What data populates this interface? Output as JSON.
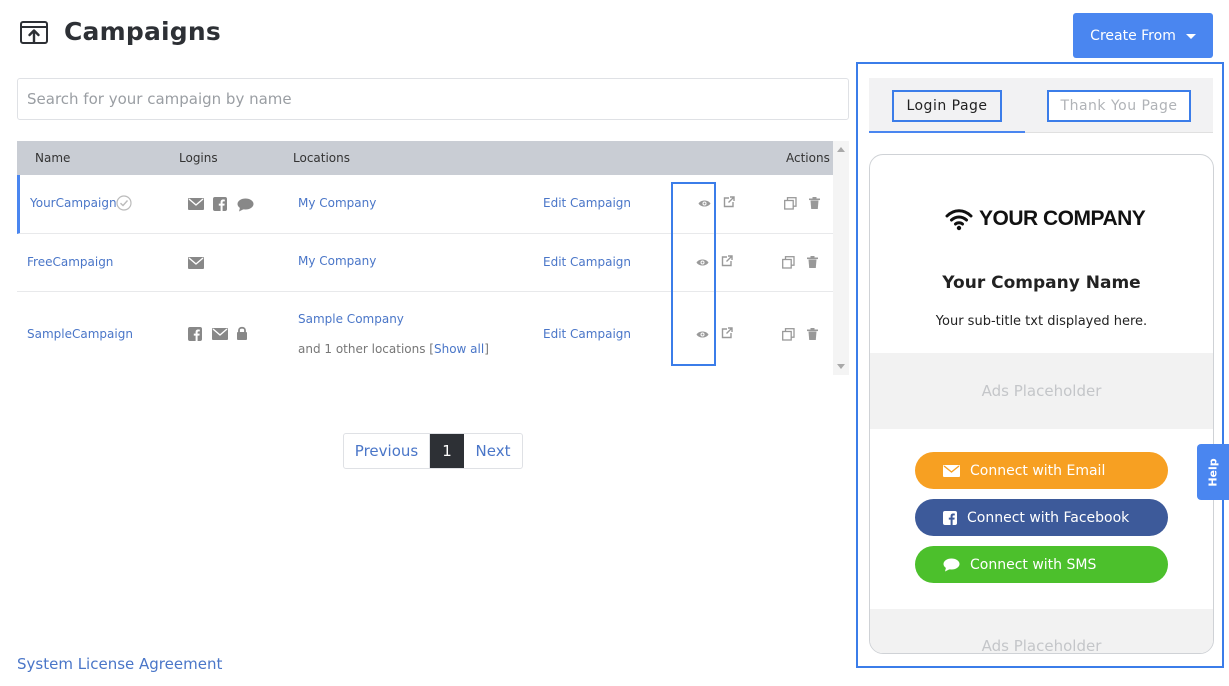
{
  "header": {
    "title": "Campaigns",
    "create_label": "Create From",
    "title_icon": "upload-box-icon"
  },
  "search": {
    "placeholder": "Search for your campaign by name",
    "value": ""
  },
  "table": {
    "columns": [
      "Name",
      "Logins",
      "Locations",
      "Actions"
    ],
    "rows": [
      {
        "name": "YourCampaign",
        "verified": true,
        "logins": [
          "email-icon",
          "facebook-icon",
          "sms-icon"
        ],
        "location": "My Company",
        "location_extra": "",
        "edit_label": "Edit Campaign"
      },
      {
        "name": "FreeCampaign",
        "verified": false,
        "logins": [
          "email-icon"
        ],
        "location": "My Company",
        "location_extra": "",
        "edit_label": "Edit Campaign"
      },
      {
        "name": "SampleCampaign",
        "verified": false,
        "logins": [
          "facebook-icon",
          "email-icon",
          "lock-icon"
        ],
        "location": "Sample Company",
        "location_extra": "and 1 other locations [",
        "show_all": "Show all",
        "show_all_close": "]",
        "edit_label": "Edit Campaign"
      }
    ]
  },
  "pagination": {
    "previous": "Previous",
    "current": "1",
    "next": "Next"
  },
  "footer": {
    "license_link": "System License Agreement"
  },
  "preview": {
    "tabs": {
      "login": "Login Page",
      "thanks": "Thank You Page"
    },
    "logo_text": "YOUR COMPANY",
    "company_name": "Your Company Name",
    "subtitle": "Your sub-title txt displayed here.",
    "ads_placeholder": "Ads Placeholder",
    "buttons": {
      "email": "Connect with Email",
      "facebook": "Connect with Facebook",
      "sms": "Connect with SMS"
    }
  },
  "help_label": "Help",
  "colors": {
    "accent": "#4a86f0",
    "link": "#4a76c8",
    "email_btn": "#f7a022",
    "facebook_btn": "#3b5998",
    "sms_btn": "#4cc02c",
    "table_header": "#c9cdd4",
    "highlight": "#3b7de9"
  }
}
